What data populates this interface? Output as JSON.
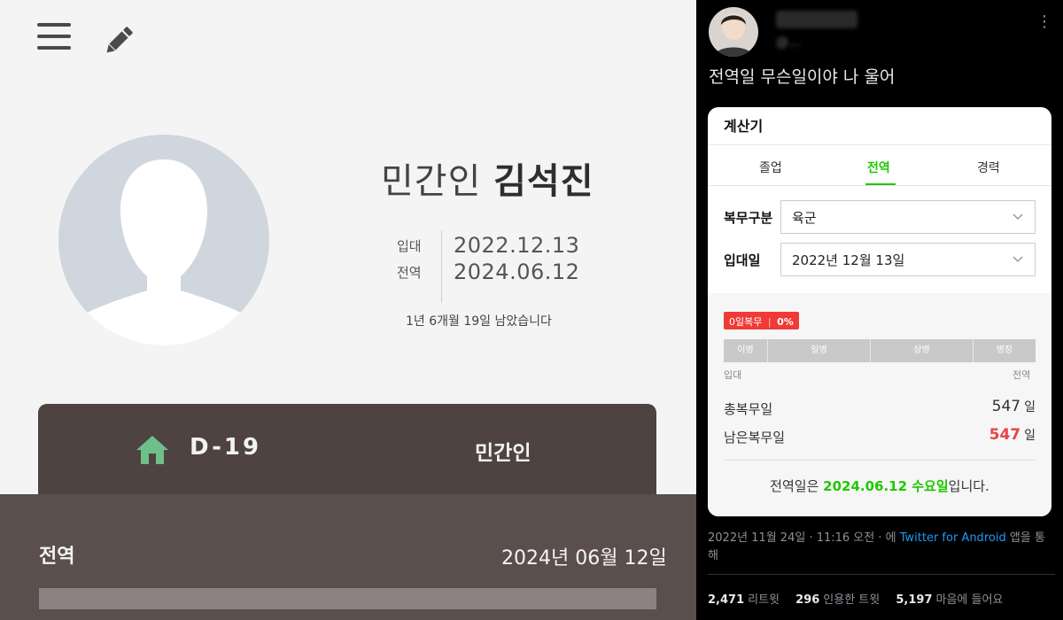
{
  "left_app": {
    "name_prefix": "민간인",
    "name": "김석진",
    "enlist_label": "입대",
    "enlist_date": "2022.12.13",
    "discharge_label": "전역",
    "discharge_date": "2024.06.12",
    "remaining_text": "1년 6개월 19일 남았습니다",
    "dday": "D-19",
    "status": "민간인",
    "bottom_label": "전역",
    "bottom_date": "2024년 06월 12일"
  },
  "tweet": {
    "handle": "@...",
    "text": "전역일 무슨일이야 나 울어",
    "more": "⋮",
    "calculator": {
      "title": "계산기",
      "tabs": [
        "졸업",
        "전역",
        "경력"
      ],
      "active_tab": "전역",
      "service_type_label": "복무구분",
      "service_type_value": "육군",
      "enlist_label": "입대일",
      "enlist_value": "2022년 12월 13일",
      "badge_days": "0일복무",
      "badge_sep": "|",
      "badge_pct": "0%",
      "progress_pct": 0,
      "ranks": [
        "이병",
        "일병",
        "상병",
        "병장"
      ],
      "axis_start": "입대",
      "axis_end": "전역",
      "total_label": "총복무일",
      "total_value": "547",
      "remain_label": "남은복무일",
      "remain_value": "547",
      "unit": "일",
      "result_prefix": "전역일은 ",
      "result_date": "2024.06.12 수요일",
      "result_suffix": "입니다."
    },
    "meta": {
      "datetime": "2022년 11월 24일 · 11:16 오전 · 에 ",
      "client": "Twitter for Android",
      "client_suffix": " 앱을 통해"
    },
    "stats": {
      "retweets_num": "2,471",
      "retweets_label": "리트윗",
      "quotes_num": "296",
      "quotes_label": "인용한 트윗",
      "likes_num": "5,197",
      "likes_label": "마음에 들어요"
    }
  },
  "colors": {
    "card_brown": "#4e4341",
    "band_brown": "#5a4f4d",
    "naver_green": "#1ec800",
    "alert_red": "#e94444",
    "twitter_blue": "#1d9bf0"
  }
}
